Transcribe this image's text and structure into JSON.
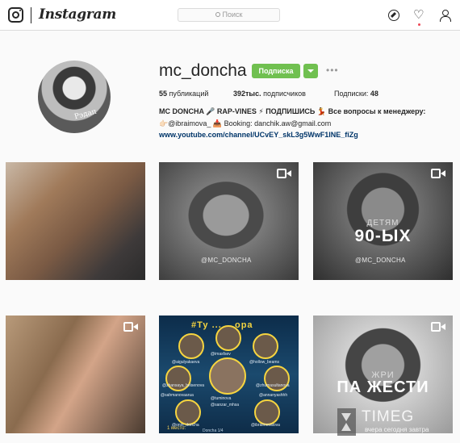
{
  "topnav": {
    "wordmark": "Instagram",
    "search_placeholder": "Поиск",
    "icons": [
      "camera-logo-icon",
      "compass-icon",
      "heart-icon",
      "user-icon"
    ]
  },
  "profile": {
    "username": "mc_doncha",
    "follow_label": "Подписка",
    "more_label": "•••",
    "avatar_caption": "Рэдап",
    "posts_count": "55",
    "posts_label": "публикаций",
    "followers_count": "392тыс.",
    "followers_label": "подписчиков",
    "following_label": "Подписки:",
    "following_count": "48",
    "bio_name": "MC DONCHA 🎤 RAP-VINES ⚡ ПОДПИШИСЬ 💃 Все вопросы к менеджеру:",
    "bio_line": "👉🏻@ibraimova_ 📥 Booking: danchik.aw@gmail.com",
    "bio_link": "www.youtube.com/channel/UCvEY_skL3g5WwF1INE_fiZg"
  },
  "posts": {
    "p2_watermark": "@MC_DONCHA",
    "p3_overlay_small": "ДЕТЯМ",
    "p3_overlay_big": "90-ЫХ",
    "p3_watermark": "@MC_DONCHA",
    "p5_title": "#Ту ...  ...ора",
    "p5_handles": [
      "@aigulyakaeva",
      "@imasfsev",
      "@hollow_beams",
      "@sahmanovaarua",
      "@tuminova",
      "@annanyashhh",
      "@zhumasultanova",
      "@zhansaya_beisenova",
      "@sanzar_mhsa",
      "@onin_doncha",
      "@ibraimovalova"
    ],
    "p5_rank": "1 место:",
    "p5_sub": "Doncha 1/4",
    "p6_overlay_small": "ЖРИ",
    "p6_overlay_big": "ПА ЖЕСТИ"
  },
  "overlay_watermark": {
    "title": "TIMEG",
    "subtitle": "вчера сегодня завтра"
  }
}
